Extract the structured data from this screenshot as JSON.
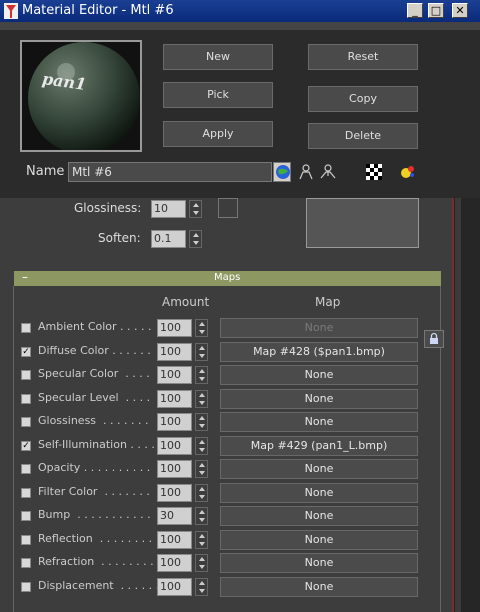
{
  "window": {
    "title": "Material Editor - Mtl #6"
  },
  "window_controls": {
    "minimize": "_",
    "maximize": "□",
    "close": "✕"
  },
  "preview": {
    "sample_text": "pan1"
  },
  "buttons": {
    "new": "New",
    "reset": "Reset",
    "pick": "Pick",
    "copy": "Copy",
    "apply": "Apply",
    "delete": "Delete"
  },
  "name": {
    "label": "Name",
    "value": "Mtl #6",
    "dropdown_glyph": "▼"
  },
  "toolbar_icons": [
    "globe-icon",
    "pick-object-icon",
    "sticky-figure-icon",
    "checker-icon",
    "color-dots-icon"
  ],
  "params": {
    "glossiness_label": "Glossiness:",
    "glossiness_value": "10",
    "soften_label": "Soften:",
    "soften_value": "0.1"
  },
  "maps": {
    "title": "Maps",
    "collapse_glyph": "–",
    "amount_header": "Amount",
    "map_header": "Map",
    "lock_glyph": "🔒",
    "rows": [
      {
        "label": "Ambient Color . . . . .",
        "checked": "",
        "amount": "100",
        "map": "None",
        "dim": true
      },
      {
        "label": "Diffuse Color . . . . . .",
        "checked": "✓",
        "amount": "100",
        "map": "Map #428 ($pan1.bmp)",
        "dim": false
      },
      {
        "label": "Specular Color  . . . .",
        "checked": "",
        "amount": "100",
        "map": "None",
        "dim": false
      },
      {
        "label": "Specular Level  . . . .",
        "checked": "",
        "amount": "100",
        "map": "None",
        "dim": false
      },
      {
        "label": "Glossiness  . . . . . . .",
        "checked": "",
        "amount": "100",
        "map": "None",
        "dim": false
      },
      {
        "label": "Self-Illumination . . . .",
        "checked": "✓",
        "amount": "100",
        "map": "Map #429 (pan1_L.bmp)",
        "dim": false
      },
      {
        "label": "Opacity . . . . . . . . . .",
        "checked": "",
        "amount": "100",
        "map": "None",
        "dim": false
      },
      {
        "label": "Filter Color  . . . . . . .",
        "checked": "",
        "amount": "100",
        "map": "None",
        "dim": false
      },
      {
        "label": "Bump  . . . . . . . . . . .",
        "checked": "",
        "amount": "30",
        "map": "None",
        "dim": false
      },
      {
        "label": "Reflection  . . . . . . . .",
        "checked": "",
        "amount": "100",
        "map": "None",
        "dim": false
      },
      {
        "label": "Refraction  . . . . . . . .",
        "checked": "",
        "amount": "100",
        "map": "None",
        "dim": false
      },
      {
        "label": "Displacement  . . . . . .",
        "checked": "",
        "amount": "100",
        "map": "None",
        "dim": false
      }
    ]
  },
  "colors": {
    "title_bar": "#0a2a7a",
    "maps_header": "#8c9762",
    "panel": "#3d3d3d"
  }
}
